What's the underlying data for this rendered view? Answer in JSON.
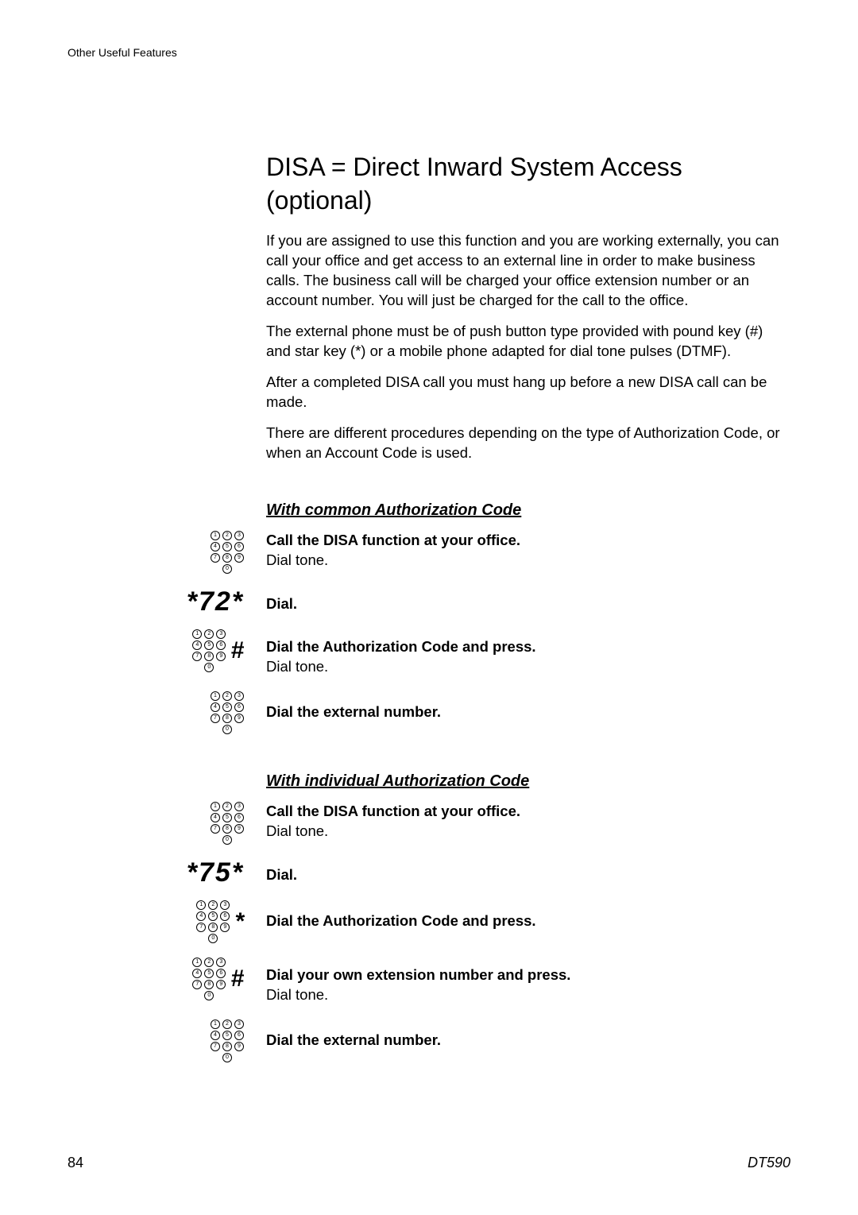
{
  "header": {
    "section": "Other Useful Features"
  },
  "main": {
    "title": "DISA = Direct Inward System Access (optional)",
    "paragraphs": [
      "If you are assigned to use this function and you are working externally, you can call your office and get access to an external line in order to make business calls. The business call will be charged your office extension number or an account number. You will just be charged for the call to the office.",
      "The external phone must be of push button type provided with pound key (#) and star key (*) or a mobile phone adapted for dial tone pulses (DTMF).",
      "After a completed DISA call you must hang up before a new DISA call can be made.",
      "There are different procedures depending on the type of Authorization Code, or when an Account Code is used."
    ],
    "common": {
      "heading": "With common Authorization Code",
      "steps": [
        {
          "icon": "keypad",
          "bold": "Call the DISA function at your office.",
          "light": "Dial tone."
        },
        {
          "icon": "code72",
          "code": "*72*",
          "bold": "Dial."
        },
        {
          "icon": "keypad-hash",
          "sym": "#",
          "bold": "Dial the Authorization Code and press.",
          "light": "Dial tone."
        },
        {
          "icon": "keypad",
          "bold": "Dial the external number."
        }
      ]
    },
    "individual": {
      "heading": "With individual Authorization Code",
      "steps": [
        {
          "icon": "keypad",
          "bold": "Call the DISA function at your office.",
          "light": "Dial tone."
        },
        {
          "icon": "code75",
          "code": "*75*",
          "bold": "Dial."
        },
        {
          "icon": "keypad-star",
          "sym": "*",
          "bold": "Dial the Authorization Code and press."
        },
        {
          "icon": "keypad-hash",
          "sym": "#",
          "bold": "Dial your own extension number and press.",
          "light": "Dial tone."
        },
        {
          "icon": "keypad",
          "bold": "Dial the external number."
        }
      ]
    }
  },
  "footer": {
    "page": "84",
    "model": "DT590"
  }
}
